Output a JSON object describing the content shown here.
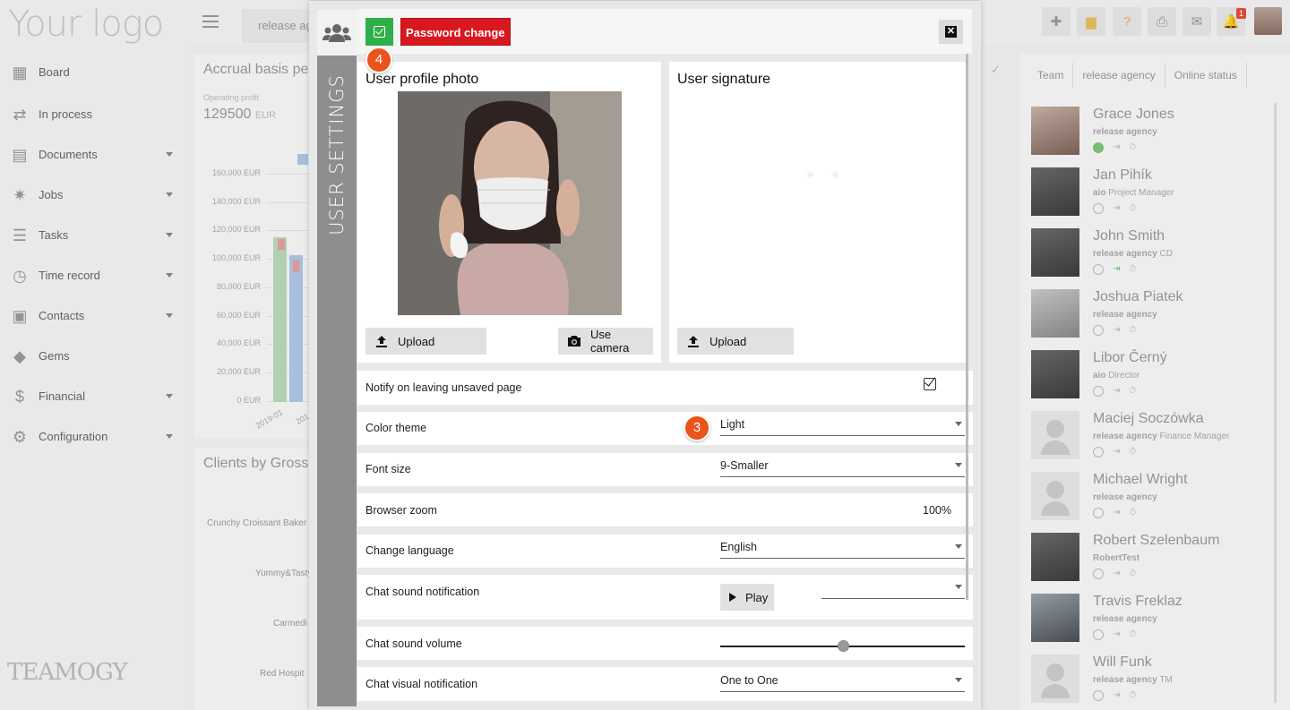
{
  "app": {
    "logo_text": "Your logo",
    "brand_bottom": "TEAMOGY",
    "sidebar_items": [
      {
        "label": "Board",
        "icon": "grid-icon",
        "has_caret": false
      },
      {
        "label": "In process",
        "icon": "flow-icon",
        "has_caret": false
      },
      {
        "label": "Documents",
        "icon": "document-icon",
        "has_caret": true
      },
      {
        "label": "Jobs",
        "icon": "jobs-icon",
        "has_caret": true
      },
      {
        "label": "Tasks",
        "icon": "tasks-icon",
        "has_caret": true
      },
      {
        "label": "Time record",
        "icon": "clock-icon",
        "has_caret": true
      },
      {
        "label": "Contacts",
        "icon": "contacts-icon",
        "has_caret": true
      },
      {
        "label": "Gems",
        "icon": "gem-icon",
        "has_caret": false
      },
      {
        "label": "Financial",
        "icon": "dollar-icon",
        "has_caret": true
      },
      {
        "label": "Configuration",
        "icon": "gear-icon",
        "has_caret": true
      }
    ],
    "top_tab": "release ag",
    "notification_count": "1",
    "card_accrual": {
      "title": "Accrual basis pe",
      "subtitle": "Operating profit",
      "value": "129500",
      "unit": "EUR",
      "y_ticks": [
        "160,000 EUR",
        "140,000 EUR",
        "120,000 EUR",
        "100,000 EUR",
        "80,000 EUR",
        "60,000 EUR",
        "40,000 EUR",
        "20,000 EUR",
        "0 EUR"
      ],
      "x_ticks": [
        "2019-01",
        "201"
      ]
    },
    "card_clients": {
      "title": "Clients by Gross",
      "clients": [
        "Crunchy Croissant Baker",
        "Yummy&Tasty",
        "Carmedi",
        "Red Hospit"
      ]
    },
    "breadcrumb": [
      "Team",
      "release agency",
      "Online status"
    ],
    "users": [
      {
        "name": "Grace Jones",
        "company": "release agency",
        "role": "",
        "online": true
      },
      {
        "name": "Jan Pihík",
        "company": "aio",
        "role": "Project Manager",
        "online": false
      },
      {
        "name": "John Smith",
        "company": "release agency",
        "role": "CD",
        "online": false
      },
      {
        "name": "Joshua Piatek",
        "company": "release agency",
        "role": "",
        "online": false
      },
      {
        "name": "Libor Černý",
        "company": "aio",
        "role": "Director",
        "online": false
      },
      {
        "name": "Maciej Soczówka",
        "company": "release agency",
        "role": "Finance Manager",
        "online": false
      },
      {
        "name": "Michael Wright",
        "company": "release agency",
        "role": "",
        "online": false
      },
      {
        "name": "Robert Szelenbaum",
        "company": "RobertTest",
        "role": "",
        "online": false
      },
      {
        "name": "Travis Freklaz",
        "company": "release agency",
        "role": "",
        "online": false
      },
      {
        "name": "Will Funk",
        "company": "release agency",
        "role": "TM",
        "online": false
      }
    ]
  },
  "modal": {
    "side_title": "USER SETTINGS",
    "password_button": "Password change",
    "step_4": "4",
    "step_3": "3",
    "profile_photo_title": "User profile photo",
    "signature_title": "User signature",
    "upload_label": "Upload",
    "camera_label": "Use camera",
    "settings": {
      "notify_label": "Notify on leaving unsaved page",
      "notify_checked": true,
      "color_theme_label": "Color theme",
      "color_theme_value": "Light",
      "font_size_label": "Font size",
      "font_size_value": "9-Smaller",
      "zoom_label": "Browser zoom",
      "zoom_value": "100%",
      "language_label": "Change language",
      "language_value": "English",
      "chat_sound_label": "Chat sound notification",
      "play_label": "Play",
      "chat_sound_value": "",
      "volume_label": "Chat sound volume",
      "volume_level": 0.5,
      "chat_visual_label": "Chat visual notification",
      "chat_visual_value": "One to One"
    }
  }
}
